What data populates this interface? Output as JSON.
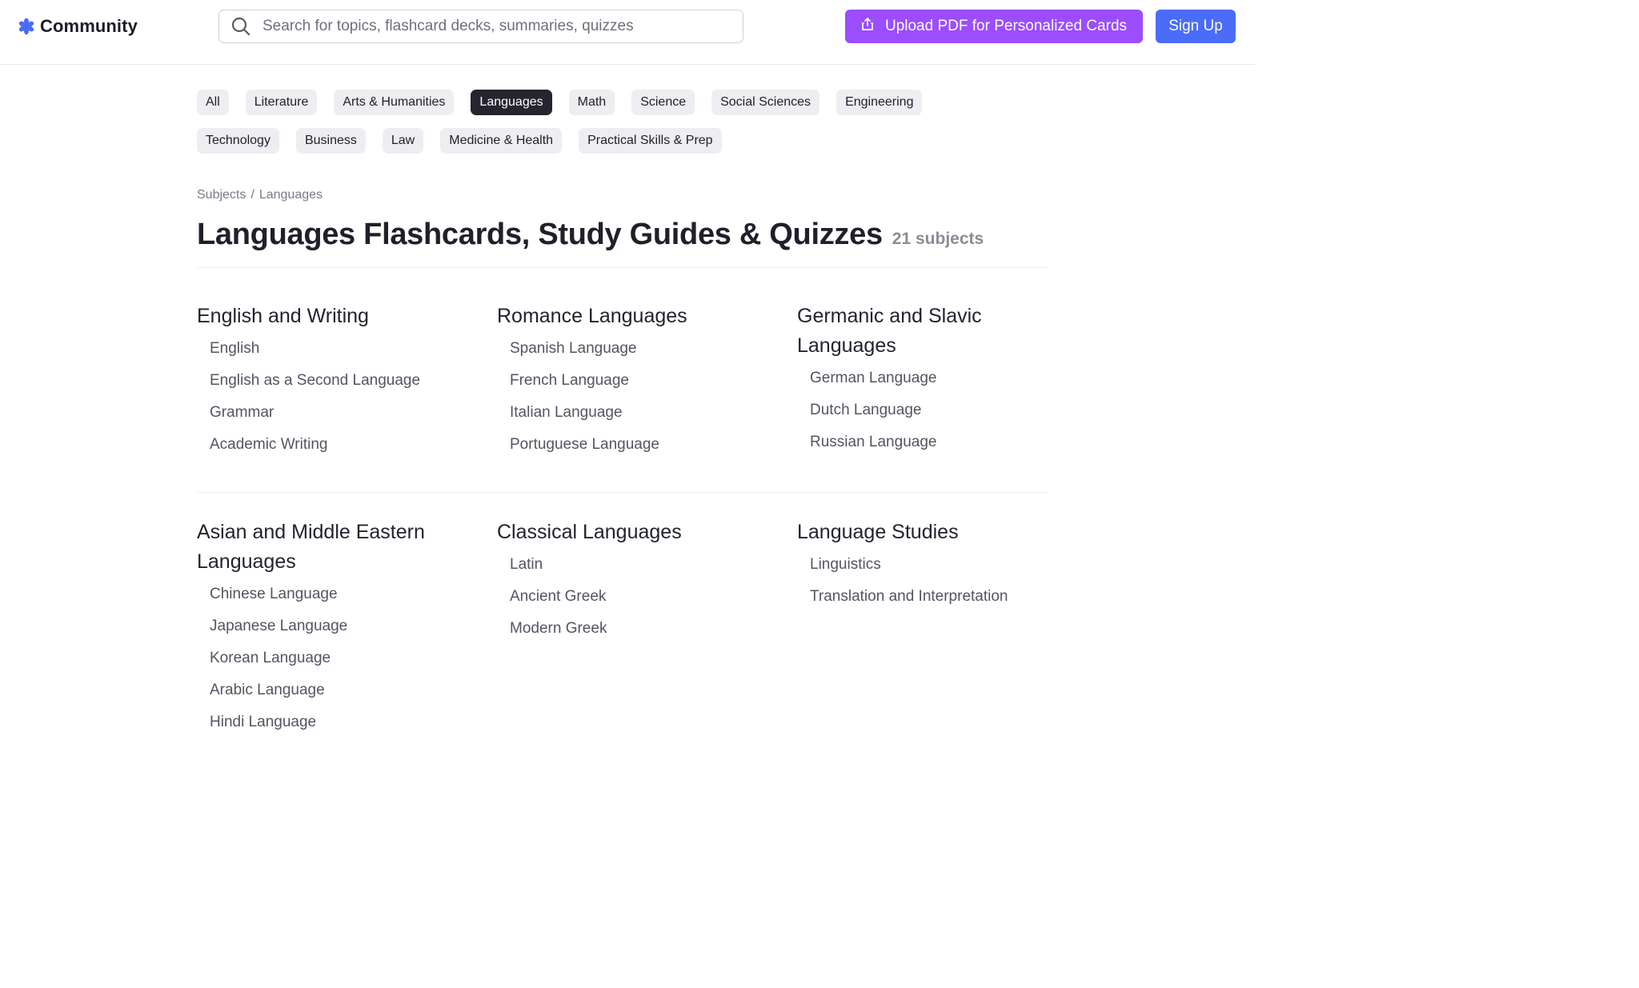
{
  "header": {
    "logo_text": "Community",
    "search_placeholder": "Search for topics, flashcard decks, summaries, quizzes",
    "upload_label": "Upload PDF for Personalized Cards",
    "signup_label": "Sign Up"
  },
  "colors": {
    "upload_button": "#9b4dff",
    "signup_button": "#4a6cf7",
    "active_chip": "#252530",
    "logo_icon": "#4a6cf7"
  },
  "icons": {
    "logo": "gear-flower-icon",
    "search": "search-icon",
    "upload": "upload-icon"
  },
  "chips": {
    "row1": [
      {
        "label": "All",
        "active": false
      },
      {
        "label": "Literature",
        "active": false
      },
      {
        "label": "Arts & Humanities",
        "active": false
      },
      {
        "label": "Languages",
        "active": true
      },
      {
        "label": "Math",
        "active": false
      },
      {
        "label": "Science",
        "active": false
      },
      {
        "label": "Social Sciences",
        "active": false
      },
      {
        "label": "Engineering",
        "active": false
      }
    ],
    "row2": [
      {
        "label": "Technology",
        "active": false
      },
      {
        "label": "Business",
        "active": false
      },
      {
        "label": "Law",
        "active": false
      },
      {
        "label": "Medicine & Health",
        "active": false
      },
      {
        "label": "Practical Skills & Prep",
        "active": false
      }
    ]
  },
  "breadcrumb": {
    "root": "Subjects",
    "separator": "/",
    "current": "Languages"
  },
  "page": {
    "title": "Languages Flashcards, Study Guides & Quizzes",
    "count": "21 subjects"
  },
  "groups": [
    {
      "title": "English and Writing",
      "items": [
        "English",
        "English as a Second Language",
        "Grammar",
        "Academic Writing"
      ]
    },
    {
      "title": "Romance Languages",
      "items": [
        "Spanish Language",
        "French Language",
        "Italian Language",
        "Portuguese Language"
      ]
    },
    {
      "title": "Germanic and Slavic Languages",
      "items": [
        "German Language",
        "Dutch Language",
        "Russian Language"
      ]
    },
    {
      "title": "Asian and Middle Eastern Languages",
      "items": [
        "Chinese Language",
        "Japanese Language",
        "Korean Language",
        "Arabic Language",
        "Hindi Language"
      ]
    },
    {
      "title": "Classical Languages",
      "items": [
        "Latin",
        "Ancient Greek",
        "Modern Greek"
      ]
    },
    {
      "title": "Language Studies",
      "items": [
        "Linguistics",
        "Translation and Interpretation"
      ]
    }
  ]
}
